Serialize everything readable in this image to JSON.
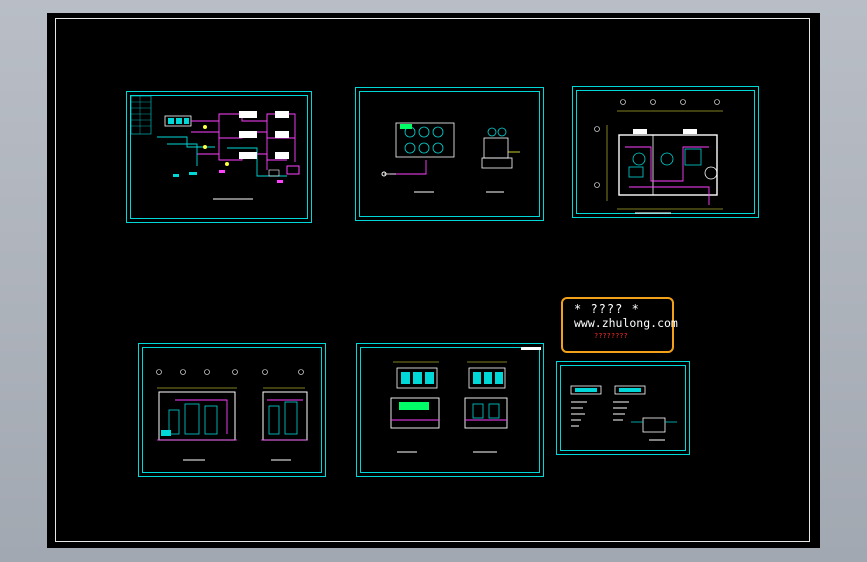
{
  "watermark": {
    "line1": "* ???? *",
    "line2": "www.zhulong.com",
    "line3": "????????"
  },
  "colors": {
    "frame": "#00d7d7",
    "pipe": "#ff40ff",
    "equipment": "#ffffff",
    "dimension": "#ffff40",
    "highlight": "#00ff66",
    "background": "#000000"
  }
}
